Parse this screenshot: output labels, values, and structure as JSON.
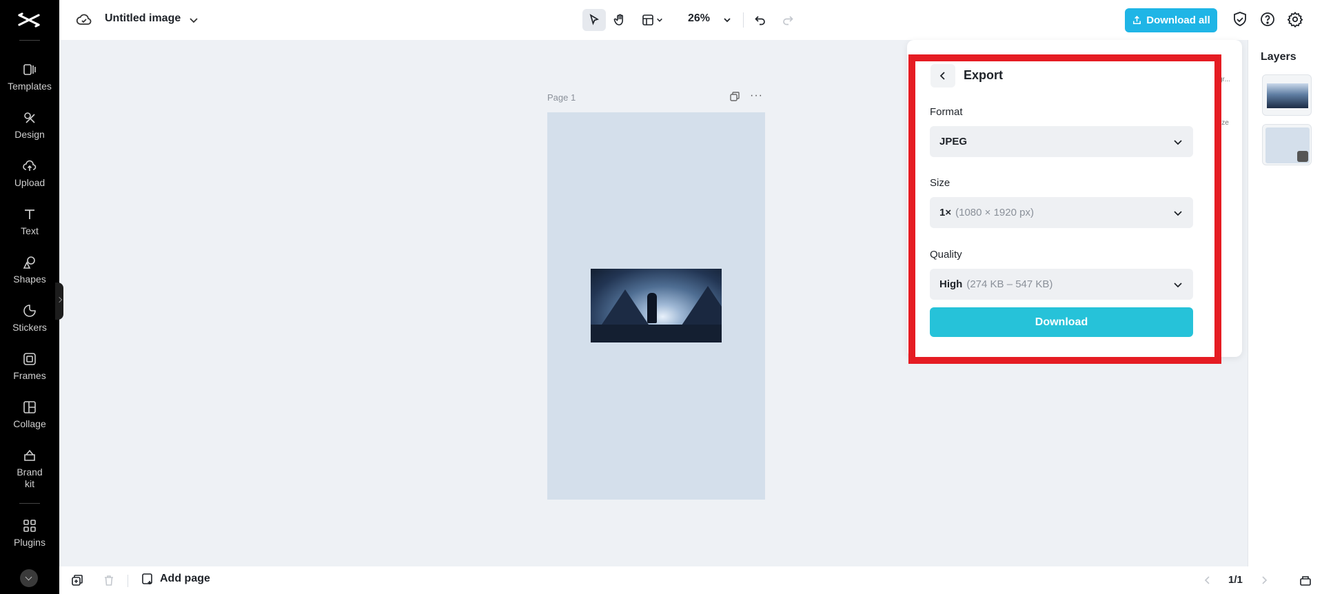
{
  "sidebar": {
    "logo": "capcut-logo",
    "items": [
      {
        "label": "Templates",
        "icon": "templates-icon"
      },
      {
        "label": "Design",
        "icon": "design-icon"
      },
      {
        "label": "Upload",
        "icon": "upload-cloud-icon"
      },
      {
        "label": "Text",
        "icon": "text-icon"
      },
      {
        "label": "Shapes",
        "icon": "shapes-icon"
      },
      {
        "label": "Stickers",
        "icon": "stickers-icon"
      },
      {
        "label": "Frames",
        "icon": "frames-icon"
      },
      {
        "label": "Collage",
        "icon": "collage-icon"
      },
      {
        "label": "Brand kit",
        "icon": "brand-kit-icon"
      },
      {
        "label": "Plugins",
        "icon": "plugins-icon"
      }
    ]
  },
  "header": {
    "doc_title": "Untitled image",
    "zoom": "26%",
    "download_all_label": "Download all"
  },
  "canvas": {
    "page_label": "Page 1"
  },
  "export": {
    "title": "Export",
    "format_label": "Format",
    "format_value": "JPEG",
    "size_label": "Size",
    "size_value": "1×",
    "size_detail": "(1080 × 1920 px)",
    "quality_label": "Quality",
    "quality_value": "High",
    "quality_detail": "(274 KB – 547 KB)",
    "download_label": "Download",
    "highlight_color": "#e51c23"
  },
  "aux_panel": {
    "peek_text_1": "gr...",
    "peek_text_2": "ize"
  },
  "layers": {
    "title": "Layers"
  },
  "footer": {
    "add_page_label": "Add page",
    "page_count": "1/1"
  },
  "colors": {
    "accent": "#1fb5e6",
    "download_button": "#26c2d9",
    "sidebar_bg": "#000000",
    "canvas_bg": "#eef1f5",
    "page_bg": "#d4dfeb"
  }
}
